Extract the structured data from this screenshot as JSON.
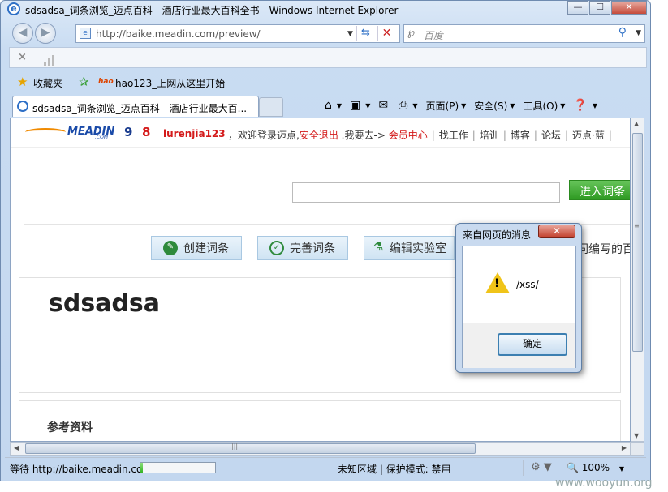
{
  "window": {
    "title": "sdsadsa_词条浏览_迈点百科 - 酒店行业最大百科全书 - Windows Internet Explorer",
    "controls": {
      "minimize": "—",
      "maximize": "☐",
      "close": "✕"
    }
  },
  "address_bar": {
    "url": "http://baike.meadin.com/preview/"
  },
  "search": {
    "placeholder": "百度"
  },
  "favorites": {
    "label": "收藏夹",
    "items": [
      {
        "label": "hao123_上网从这里开始",
        "logo": "hao"
      }
    ]
  },
  "tab": {
    "label": "sdsadsa_词条浏览_迈点百科 - 酒店行业最大百..."
  },
  "command_bar": {
    "page": "页面(P)",
    "safety": "安全(S)",
    "tools": "工具(O)"
  },
  "site": {
    "logo": "MEADIN",
    "logo_sub": ".COM",
    "logo_9": "9",
    "logo_8": "8",
    "user": "lurenjia123",
    "welcome": "，欢迎登录迈点,",
    "logout": "安全退出",
    "goto": ".我要去->",
    "member_center": "会员中心",
    "links": [
      "找工作",
      "培训",
      "博客",
      "论坛",
      "迈点·蓝"
    ],
    "enter_button": "进入词条",
    "actions": [
      {
        "label": "创建词条",
        "icon": "pencil-icon"
      },
      {
        "label": "完善词条",
        "icon": "check-icon"
      },
      {
        "label": "编辑实验室",
        "icon": "flask-icon"
      }
    ],
    "right_fragment": "同编写的百",
    "entry_title": "sdsadsa",
    "references_title": "参考资料"
  },
  "status_bar": {
    "text": "等待 http://baike.meadin.com",
    "progress": 0.03,
    "zone": "未知区域 | 保护模式: 禁用",
    "zoom": "100%"
  },
  "dialog": {
    "title": "来自网页的消息",
    "close": "✕",
    "message": "/xss/",
    "ok": "确定"
  },
  "watermark": "www.wooyun.org",
  "colors": {
    "accent_red": "#d41a1a",
    "enter_green": "#2e9a22",
    "ie_blue": "#2d6fc6"
  }
}
